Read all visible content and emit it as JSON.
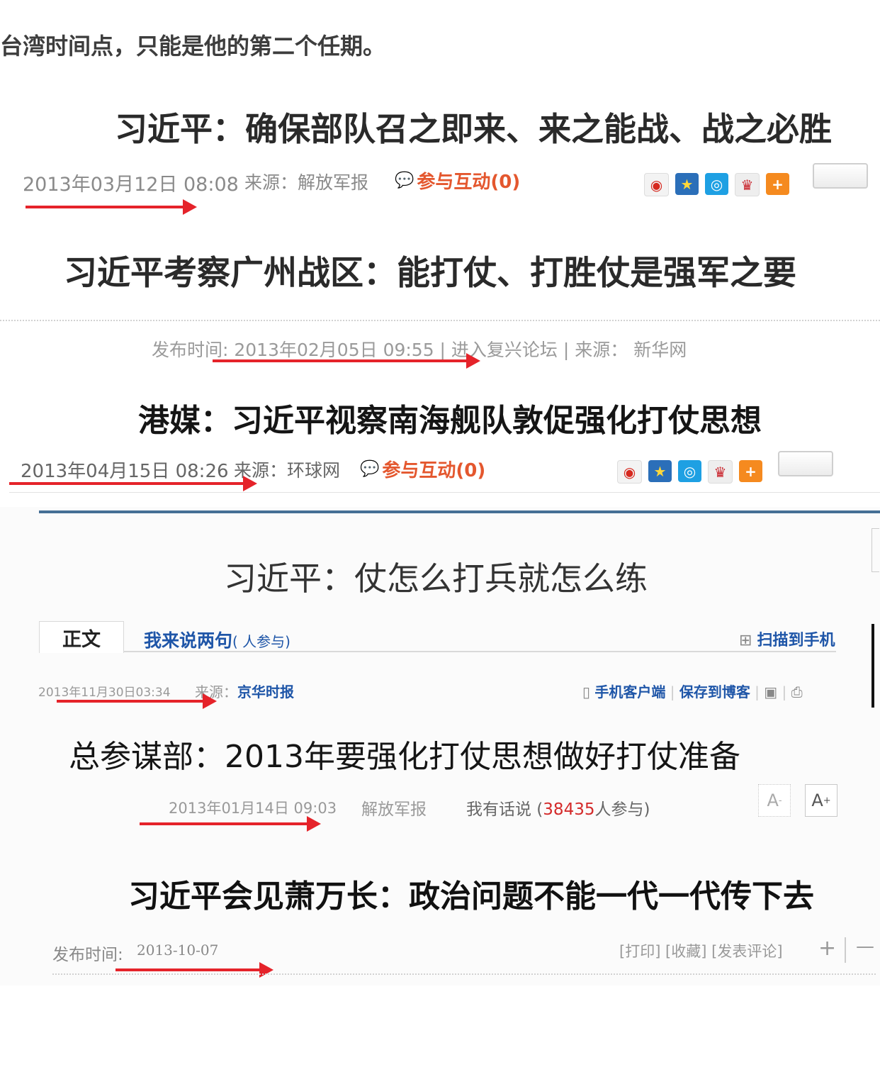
{
  "intro": "台湾时间点，只能是他的第二个任期。",
  "clip1": {
    "title": "习近平：确保部队召之即来、来之能战、战之必胜",
    "date": "2013年03月12日 08:08",
    "source": "来源：解放军报",
    "interact": "参与互动(0)"
  },
  "clip2": {
    "title": "习近平考察广州战区：能打仗、打胜仗是强军之要",
    "meta": "发布时间: 2013年02月05日 09:55 | 进入复兴论坛 | 来源： 新华网"
  },
  "clip3": {
    "title": "港媒：习近平视察南海舰队敦促强化打仗思想",
    "date": "2013年04月15日 08:26",
    "source": "来源：环球网",
    "interact": "参与互动(0)"
  },
  "clip4": {
    "title": "习近平：仗怎么打兵就怎么练",
    "tab_main": "正文",
    "tab_comment": "我来说两句",
    "tab_comment_suffix": "( 人参与)",
    "scan": "扫描到手机",
    "date": "2013年11月30日03:34",
    "source_label": "来源：",
    "source": "京华时报",
    "mobile": "手机客户端",
    "save_blog": "保存到博客"
  },
  "clip5": {
    "title": "总参谋部：2013年要强化打仗思想做好打仗准备",
    "date": "2013年01月14日 09:03",
    "source": "解放军报",
    "comment_prefix": "我有话说 (",
    "comment_count": "38435",
    "comment_suffix": "人参与)",
    "font_small": "A",
    "font_small_sup": "-",
    "font_large": "A",
    "font_large_sup": "+"
  },
  "clip6": {
    "title": "习近平会见萧万长：政治问题不能一代一代传下去",
    "date_label": "发布时间:",
    "date": "2013-10-07",
    "actions": "[打印] [收藏] [发表评论]",
    "plus": "+",
    "minus": "—"
  },
  "colors": {
    "arrow": "#e5232a",
    "accent_blue": "#1f56a8",
    "interact_orange": "#e4572e",
    "rule_blue": "#456f95"
  }
}
